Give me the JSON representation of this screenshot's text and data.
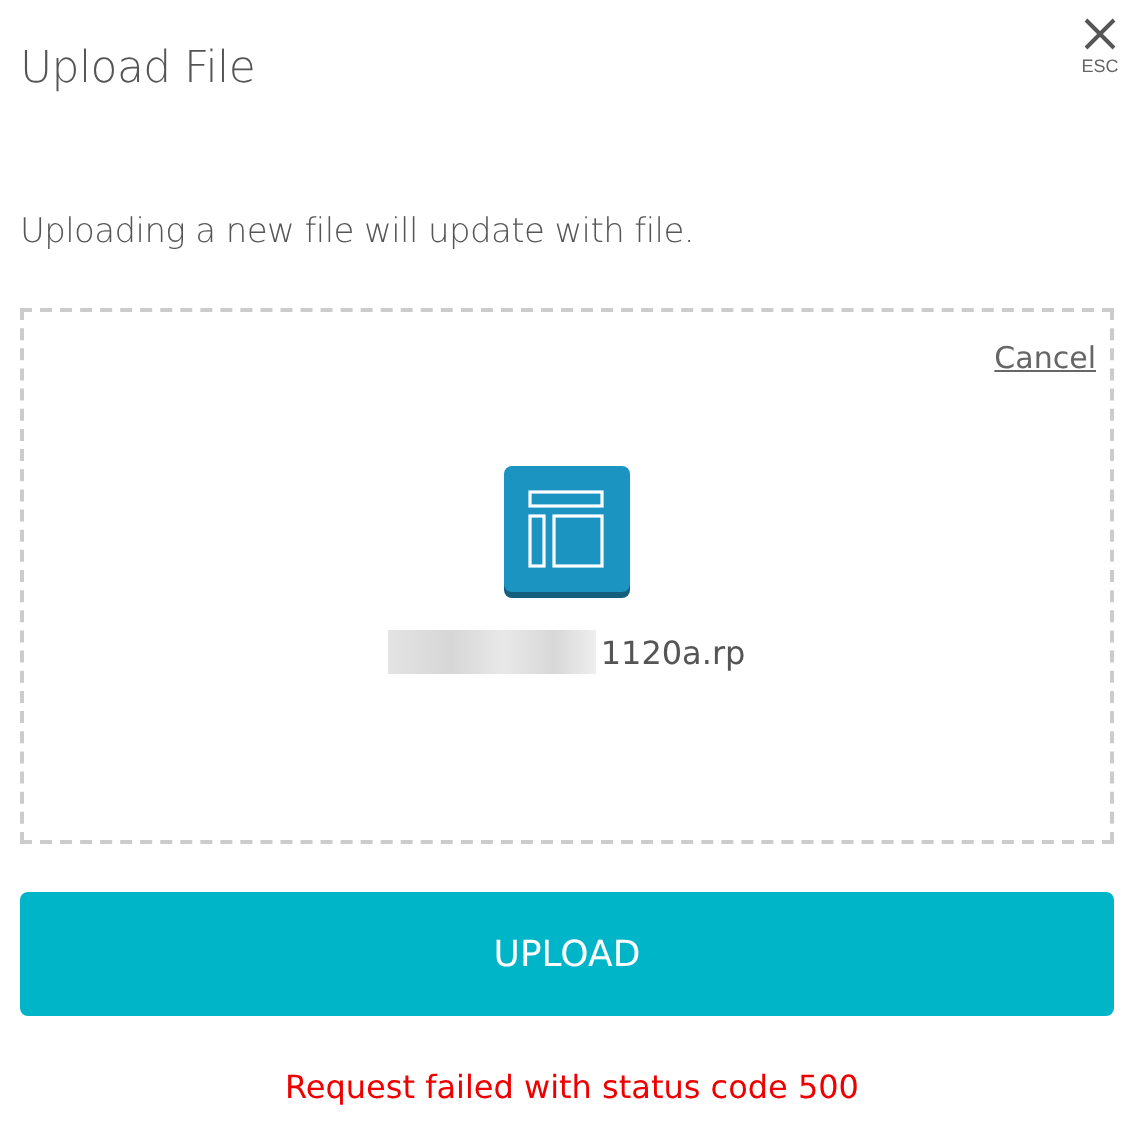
{
  "dialog": {
    "title": "Upload File",
    "close_hint": "ESC"
  },
  "description": "Uploading a new file will update with file.",
  "dropzone": {
    "cancel": "Cancel",
    "file_name": "1120a.rp",
    "name_redacted": true
  },
  "upload_button": "UPLOAD",
  "error": "Request failed with status code 500"
}
